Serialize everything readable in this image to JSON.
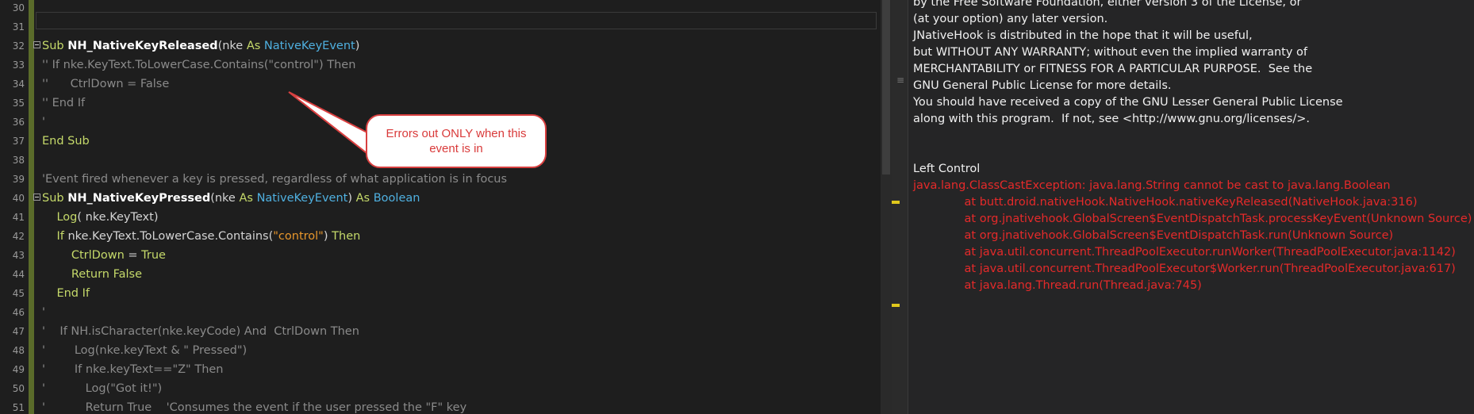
{
  "editor": {
    "lines": [
      {
        "num": "30",
        "segs": []
      },
      {
        "num": "31",
        "segs": []
      },
      {
        "num": "32",
        "fold": true,
        "segs": [
          {
            "c": "kw",
            "t": "Sub "
          },
          {
            "c": "fn",
            "t": "NH_NativeKeyReleased"
          },
          {
            "c": "tx",
            "t": "(nke "
          },
          {
            "c": "kw",
            "t": "As "
          },
          {
            "c": "ty",
            "t": "NativeKeyEvent"
          },
          {
            "c": "tx",
            "t": ")"
          }
        ]
      },
      {
        "num": "33",
        "segs": [
          {
            "c": "cm",
            "t": "'' If nke.KeyText.ToLowerCase.Contains(\"control\") Then"
          }
        ]
      },
      {
        "num": "34",
        "segs": [
          {
            "c": "cm",
            "t": "''      CtrlDown = False"
          }
        ]
      },
      {
        "num": "35",
        "segs": [
          {
            "c": "cm",
            "t": "'' End If"
          }
        ]
      },
      {
        "num": "36",
        "segs": [
          {
            "c": "cm",
            "t": "'"
          }
        ]
      },
      {
        "num": "37",
        "segs": [
          {
            "c": "kw",
            "t": "End Sub"
          }
        ]
      },
      {
        "num": "38",
        "segs": []
      },
      {
        "num": "39",
        "segs": [
          {
            "c": "cm",
            "t": "'Event fired whenever a key is pressed, regardless of what application is in focus"
          }
        ]
      },
      {
        "num": "40",
        "fold": true,
        "segs": [
          {
            "c": "kw",
            "t": "Sub "
          },
          {
            "c": "fn",
            "t": "NH_NativeKeyPressed"
          },
          {
            "c": "tx",
            "t": "(nke "
          },
          {
            "c": "kw",
            "t": "As "
          },
          {
            "c": "ty",
            "t": "NativeKeyEvent"
          },
          {
            "c": "tx",
            "t": ") "
          },
          {
            "c": "kw",
            "t": "As "
          },
          {
            "c": "ty",
            "t": "Boolean"
          }
        ]
      },
      {
        "num": "41",
        "segs": [
          {
            "c": "tx",
            "t": "    "
          },
          {
            "c": "kw",
            "t": "Log"
          },
          {
            "c": "tx",
            "t": "( nke.KeyText)"
          }
        ]
      },
      {
        "num": "42",
        "segs": [
          {
            "c": "tx",
            "t": "    "
          },
          {
            "c": "kw",
            "t": "If "
          },
          {
            "c": "tx",
            "t": "nke.KeyText.ToLowerCase.Contains("
          },
          {
            "c": "st",
            "t": "\"control\""
          },
          {
            "c": "tx",
            "t": ") "
          },
          {
            "c": "kw",
            "t": "Then"
          }
        ]
      },
      {
        "num": "43",
        "segs": [
          {
            "c": "tx",
            "t": "        "
          },
          {
            "c": "hi",
            "t": "CtrlDown "
          },
          {
            "c": "tx",
            "t": "= "
          },
          {
            "c": "kw",
            "t": "True"
          }
        ]
      },
      {
        "num": "44",
        "segs": [
          {
            "c": "tx",
            "t": "        "
          },
          {
            "c": "kw",
            "t": "Return False"
          }
        ]
      },
      {
        "num": "45",
        "segs": [
          {
            "c": "tx",
            "t": "    "
          },
          {
            "c": "kw",
            "t": "End If"
          }
        ]
      },
      {
        "num": "46",
        "segs": [
          {
            "c": "cm",
            "t": "'"
          }
        ]
      },
      {
        "num": "47",
        "segs": [
          {
            "c": "cm",
            "t": "'    If NH.isCharacter(nke.keyCode) And  CtrlDown Then"
          }
        ]
      },
      {
        "num": "48",
        "segs": [
          {
            "c": "cm",
            "t": "'        Log(nke.keyText & \" Pressed\")"
          }
        ]
      },
      {
        "num": "49",
        "segs": [
          {
            "c": "cm",
            "t": "'        If nke.keyText==\"Z\" Then"
          }
        ]
      },
      {
        "num": "50",
        "segs": [
          {
            "c": "cm",
            "t": "'           Log(\"Got it!\")"
          }
        ]
      },
      {
        "num": "51",
        "segs": [
          {
            "c": "cm",
            "t": "'           Return True    'Consumes the event if the user pressed the \"F\" key"
          }
        ]
      }
    ]
  },
  "callout": {
    "text": "Errors out ONLY when this event is in"
  },
  "log": {
    "lines": [
      {
        "t": "by the Free Software Foundation, either version 3 of the License, or",
        "err": false
      },
      {
        "t": "(at your option) any later version.",
        "err": false
      },
      {
        "t": "JNativeHook is distributed in the hope that it will be useful,",
        "err": false
      },
      {
        "t": "but WITHOUT ANY WARRANTY; without even the implied warranty of",
        "err": false
      },
      {
        "t": "MERCHANTABILITY or FITNESS FOR A PARTICULAR PURPOSE.  See the",
        "err": false
      },
      {
        "t": "GNU General Public License for more details.",
        "err": false
      },
      {
        "t": "You should have received a copy of the GNU Lesser General Public License",
        "err": false
      },
      {
        "t": "along with this program.  If not, see <http://www.gnu.org/licenses/>.",
        "err": false
      },
      {
        "t": "",
        "err": false
      },
      {
        "t": "",
        "err": false
      },
      {
        "t": "Left Control",
        "err": false
      },
      {
        "t": "java.lang.ClassCastException: java.lang.String cannot be cast to java.lang.Boolean",
        "err": true
      },
      {
        "t": "              at butt.droid.nativeHook.NativeHook.nativeKeyReleased(NativeHook.java:316)",
        "err": true
      },
      {
        "t": "              at org.jnativehook.GlobalScreen$EventDispatchTask.processKeyEvent(Unknown Source)",
        "err": true
      },
      {
        "t": "              at org.jnativehook.GlobalScreen$EventDispatchTask.run(Unknown Source)",
        "err": true
      },
      {
        "t": "              at java.util.concurrent.ThreadPoolExecutor.runWorker(ThreadPoolExecutor.java:1142)",
        "err": true
      },
      {
        "t": "              at java.util.concurrent.ThreadPoolExecutor$Worker.run(ThreadPoolExecutor.java:617)",
        "err": true
      },
      {
        "t": "              at java.lang.Thread.run(Thread.java:745)",
        "err": true
      }
    ]
  },
  "splitter": {
    "grip": "≡"
  },
  "colors": {
    "keyword": "#c5d96a",
    "type": "#4fb0e0",
    "string": "#e8972c",
    "comment": "#8a8a8a",
    "error": "#e52a2a",
    "callout_border": "#d94040"
  }
}
